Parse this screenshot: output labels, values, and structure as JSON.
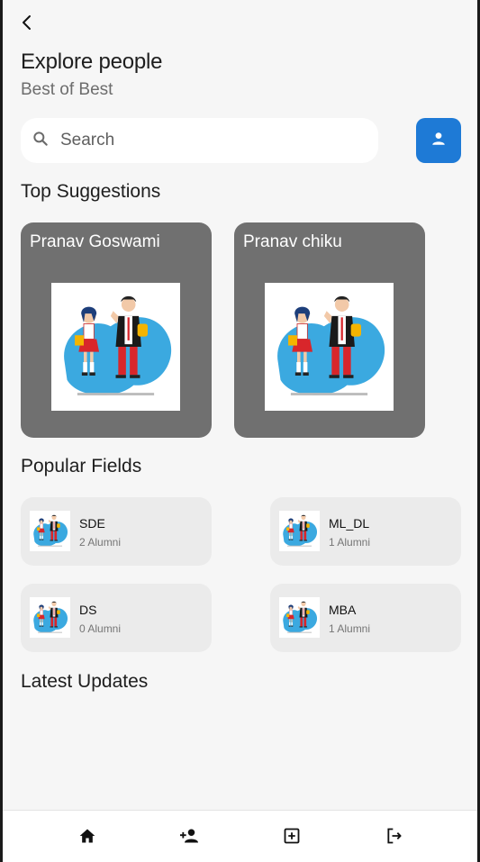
{
  "header": {
    "title": "Explore people",
    "subtitle": "Best of Best"
  },
  "search": {
    "placeholder": "Search",
    "value": ""
  },
  "sections": {
    "top_suggestions": "Top Suggestions",
    "popular_fields": "Popular Fields",
    "latest_updates": "Latest Updates"
  },
  "suggestions": [
    {
      "name": "Pranav Goswami",
      "image": "people-illustration"
    },
    {
      "name": "Pranav chiku",
      "image": "people-illustration"
    }
  ],
  "fields": [
    {
      "name": "SDE",
      "count": "2 Alumni"
    },
    {
      "name": "ML_DL",
      "count": "1 Alumni"
    },
    {
      "name": "DS",
      "count": "0 Alumni"
    },
    {
      "name": "MBA",
      "count": "1 Alumni"
    }
  ],
  "bottom_nav": [
    {
      "icon": "home-icon"
    },
    {
      "icon": "add-person-icon"
    },
    {
      "icon": "add-box-icon"
    },
    {
      "icon": "logout-icon"
    }
  ],
  "colors": {
    "accent": "#1e7ad6",
    "background": "#f6f6f6",
    "card_dark": "#707070",
    "card_light": "#ebebeb"
  }
}
